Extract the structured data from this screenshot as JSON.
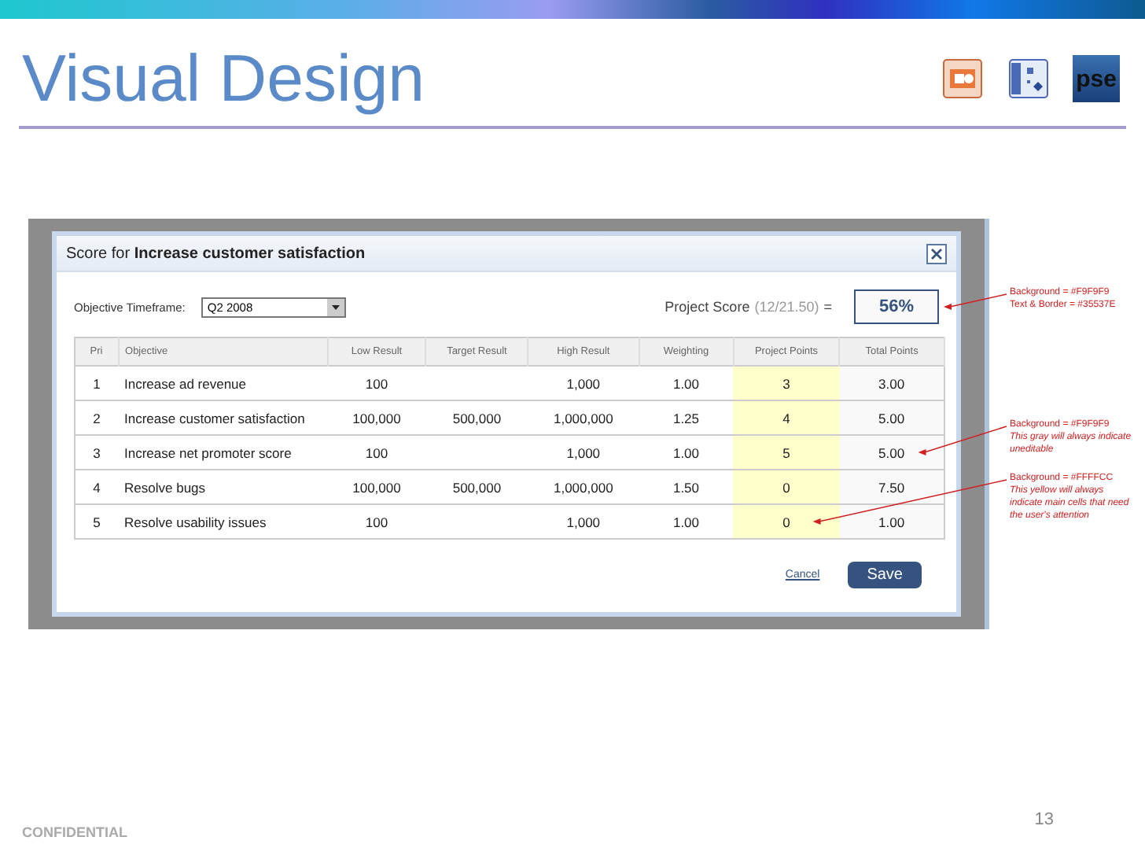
{
  "slide": {
    "title": "Visual Design",
    "logo_text": "pse",
    "footer": "CONFIDENTIAL",
    "page_number": "13"
  },
  "dialog": {
    "title": "Score for **Increase customer satisfaction**",
    "timeframe_label": "Objective Timeframe:",
    "timeframe_value": "Q2 2008",
    "score_label": "Project Score",
    "score_fraction": "(12/21.50)",
    "score_equals": "=",
    "score_value": "56%",
    "columns": [
      {
        "label": "Pri",
        "kind": "plain"
      },
      {
        "label": "Objective",
        "kind": "text"
      },
      {
        "label": "Low Result",
        "kind": "plain"
      },
      {
        "label": "Target Result",
        "kind": "plain"
      },
      {
        "label": "High Result",
        "kind": "plain"
      },
      {
        "label": "Weighting",
        "kind": "plain"
      },
      {
        "label": "Project Points",
        "kind": "attention"
      },
      {
        "label": "Total Points",
        "kind": "readonly"
      }
    ],
    "rows": [
      [
        "1",
        "Increase ad revenue",
        "100",
        "",
        "1,000",
        "1.00",
        "3",
        "3.00"
      ],
      [
        "2",
        "Increase customer satisfaction",
        "100,000",
        "500,000",
        "1,000,000",
        "1.25",
        "4",
        "5.00"
      ],
      [
        "3",
        "Increase net promoter score",
        "100",
        "",
        "1,000",
        "1.00",
        "5",
        "5.00"
      ],
      [
        "4",
        "Resolve bugs",
        "100,000",
        "500,000",
        "1,000,000",
        "1.50",
        "0",
        "7.50"
      ],
      [
        "5",
        "Resolve usability issues",
        "100",
        "",
        "1,000",
        "1.00",
        "0",
        "1.00"
      ]
    ],
    "cancel": "Cancel",
    "save": "Save"
  },
  "annotations": [
    {
      "lines": [
        "Background = #F9F9F9",
        "Text & Border = #35537E"
      ]
    },
    {
      "lines": [
        "Background = #F9F9F9"
      ],
      "note": "This gray will always indicate uneditable"
    },
    {
      "lines": [
        "Background = #FFFFCC"
      ],
      "note": "This yellow will always indicate main cells that need the user's attention"
    }
  ]
}
